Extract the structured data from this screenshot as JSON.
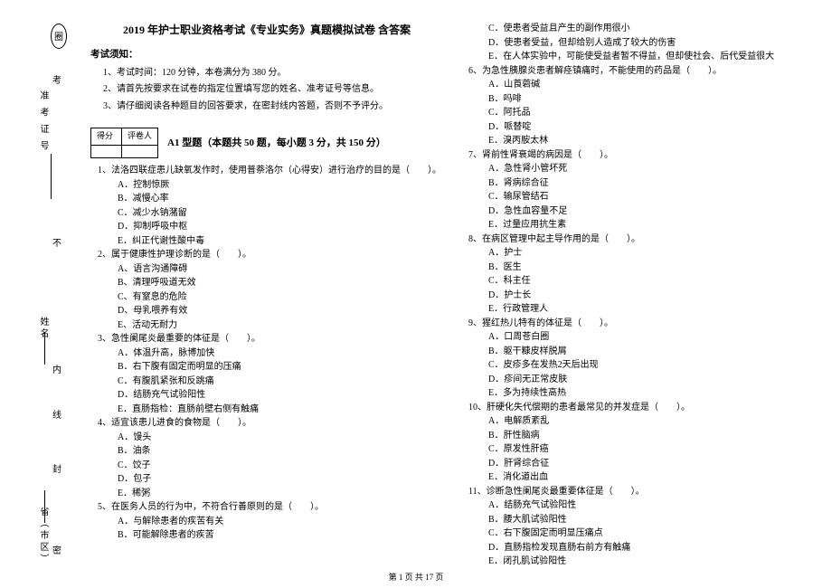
{
  "margin": {
    "ellipse_label": "圈",
    "exam_id_label": "准 考 证 号",
    "name_label": "姓名",
    "region_label": "省（市区）",
    "no_cut": "不",
    "inside": "内",
    "line": "线",
    "seal": "封",
    "secret": "密",
    "exam": "考"
  },
  "title": "2019 年护士职业资格考试《专业实务》真题模拟试卷 含答案",
  "notice_head": "考试须知：",
  "instructions": [
    "1、考试时间：120 分钟，本卷满分为 380 分。",
    "2、请首先按要求在试卷的指定位置填写您的姓名、准考证号等信息。",
    "3、请仔细阅读各种题目的回答要求，在密封线内答题，否则不予评分。"
  ],
  "score_headers": [
    "得分",
    "评卷人"
  ],
  "qtype": "A1 型题（本题共 50 题，每小题 3 分，共 150 分）",
  "left_items": [
    {
      "q": "1、法洛四联症患儿缺氧发作时，使用普萘洛尔（心得安）进行治疗的目的是（　　）。",
      "opts": [
        "A．控制惊厥",
        "B．减慢心率",
        "C．减少水钠潴留",
        "D．抑制呼吸中枢",
        "E．纠正代谢性酸中毒"
      ]
    },
    {
      "q": "2、属于健康性护理诊断的是（　　）。",
      "opts": [
        "A、语言沟通障碍",
        "B、清理呼吸道无效",
        "C、有窒息的危险",
        "D、母乳喂养有效",
        "E、活动无耐力"
      ]
    },
    {
      "q": "3、急性阑尾炎最重要的体征是（　　）。",
      "opts": [
        "A．体温升高，脉博加快",
        "B．右下腹有固定而明显的压痛",
        "C．有腹肌紧张和反跳痛",
        "D．结肠充气试验阳性",
        "E．直肠指检：直肠前壁右侧有触痛"
      ]
    },
    {
      "q": "4、适宜该患儿进食的食物是（　　）。",
      "opts": [
        "A．馒头",
        "B．油条",
        "C．饺子",
        "D．包子",
        "E．稀粥"
      ]
    },
    {
      "q": "5、在医务人员的行为中，不符合行善原则的是（　　）。",
      "opts": [
        "A．与解除患者的疾苦有关",
        "B．可能解除患者的疾苦"
      ]
    }
  ],
  "right_items": [
    {
      "q": "",
      "opts": [
        "C．使患者受益且产生的副作用很小",
        "D．使患者受益，但却给别人造成了较大的伤害",
        "E．在人体实验中，可能使受益者暂不得益，但却使社会、后代受益很大"
      ]
    },
    {
      "q": "6、为急性胰腺炎患者解痉镇痛时，不能使用的药品是（　　）。",
      "opts": [
        "A．山莨菪碱",
        "B．吗啡",
        "C．阿托品",
        "D．哌替啶",
        "E．溴丙胺太林"
      ]
    },
    {
      "q": "7、肾前性肾衰竭的病因是（　　）。",
      "opts": [
        "A．急性肾小管坏死",
        "B．肾病综合征",
        "C．输尿管结石",
        "D．急性血容量不足",
        "E．过量应用抗生素"
      ]
    },
    {
      "q": "8、在病区管理中起主导作用的是（　　）。",
      "opts": [
        "A．护士",
        "B．医生",
        "C．科主任",
        "D．护士长",
        "E．行政管理人"
      ]
    },
    {
      "q": "9、猩红热儿特有的体征是（　　）。",
      "opts": [
        "A．口周苍白圈",
        "B．躯干糠皮样脱屑",
        "C．皮疹多在发热2天后出现",
        "D．疹间无正常皮肤",
        "E．多为持续性高热"
      ]
    },
    {
      "q": "10、肝硬化失代偿期的患者最常见的并发症是（　　）。",
      "opts": [
        "A．电解质紊乱",
        "B．肝性脑病",
        "C．原发性肝癌",
        "D．肝肾综合征",
        "E．消化道出血"
      ]
    },
    {
      "q": "11、诊断急性阑尾炎最重要体征是（　　）。",
      "opts": [
        "A．结肠充气试验阳性",
        "B．腰大肌试验阳性",
        "C．右下腹固定而明显压痛点",
        "D．直肠指检发现直肠右前方有触痛",
        "E．闭孔肌试验阳性"
      ]
    }
  ],
  "footer": "第 1 页 共 17 页"
}
